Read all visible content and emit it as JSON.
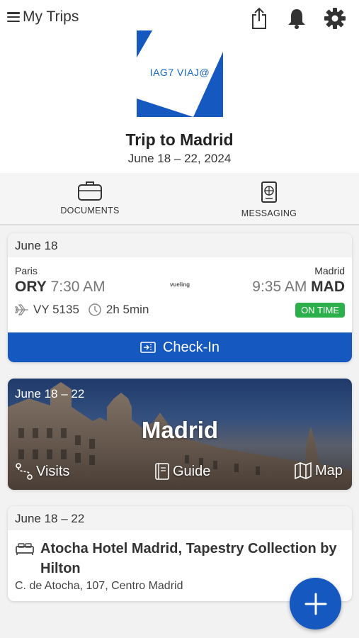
{
  "header": {
    "menu_label": "My Trips",
    "logo_text": "IAG7 VIAJ@"
  },
  "trip": {
    "title": "Trip to Madrid",
    "dates": "June 18 – 22, 2024"
  },
  "tabs": [
    {
      "label": "DOCUMENTS",
      "icon": "briefcase-icon"
    },
    {
      "label": "MESSAGING",
      "icon": "passport-icon"
    }
  ],
  "flight": {
    "date": "June 18",
    "origin_city": "Paris",
    "origin_code": "ORY",
    "departure_time": "7:30 AM",
    "airline": "vueling",
    "destination_city": "Madrid",
    "destination_code": "MAD",
    "arrival_time": "9:35 AM",
    "flight_number": "VY 5135",
    "duration": "2h 5min",
    "status": "ON TIME",
    "checkin_label": "Check-In"
  },
  "destination": {
    "dates": "June 18 – 22",
    "city": "Madrid",
    "actions": [
      "Visits",
      "Guide",
      "Map"
    ]
  },
  "hotel": {
    "dates": "June 18 – 22",
    "name": "Atocha Hotel Madrid, Tapestry Collection by Hilton",
    "address": "C. de Atocha, 107, Centro Madrid"
  },
  "colors": {
    "accent": "#1558c0",
    "status_green": "#2bb04b"
  }
}
